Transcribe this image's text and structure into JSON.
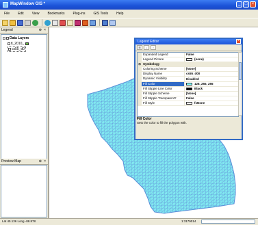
{
  "window": {
    "title": "MapWindow GIS *"
  },
  "menu": [
    "File",
    "Edit",
    "View",
    "Bookmarks",
    "Plug-ins",
    "GIS Tools",
    "Help"
  ],
  "legend": {
    "title": "Legend",
    "group": "Data Layers",
    "layers": [
      {
        "name": "tl_2010_",
        "color": "#6cbf45"
      },
      {
        "name": "cs55_d0",
        "color": "#ffffff"
      }
    ]
  },
  "preview": {
    "title": "Preview Map"
  },
  "editor": {
    "title": "Legend Editor",
    "rows": [
      {
        "type": "prop",
        "name": "Expanded Legend",
        "value": "False"
      },
      {
        "type": "prop",
        "name": "Legend Picture",
        "value": "(none)",
        "swatch": "#ffffff"
      },
      {
        "type": "cat",
        "name": "Symbology"
      },
      {
        "type": "prop",
        "name": "Coloring Scheme",
        "value": "[None]"
      },
      {
        "type": "prop",
        "name": "Display Name",
        "value": "cs55_d00"
      },
      {
        "type": "prop",
        "name": "Dynamic Visibility",
        "value": "Disabled"
      },
      {
        "type": "prop",
        "name": "Fill Color",
        "value": "128, 255, 255",
        "swatch": "#80ffff",
        "selected": true
      },
      {
        "type": "prop",
        "name": "Fill Stipple Line Color",
        "value": "Black",
        "swatch": "#000000"
      },
      {
        "type": "prop",
        "name": "Fill Stipple Scheme",
        "value": "[None]"
      },
      {
        "type": "prop",
        "name": "Fill Stipple Transparent?",
        "value": "False"
      },
      {
        "type": "prop",
        "name": "Fill Style",
        "value": "fsNone",
        "swatch": "#ffffff"
      }
    ],
    "description_title": "Fill Color",
    "description_text": "Sets the color to fill the polygon with."
  },
  "status": {
    "coords": "Lat 45.136 Long -88.878",
    "scale": "1:3179014"
  },
  "colors": {
    "fill": "#80e8f0",
    "outline": "#5a8fd8"
  }
}
